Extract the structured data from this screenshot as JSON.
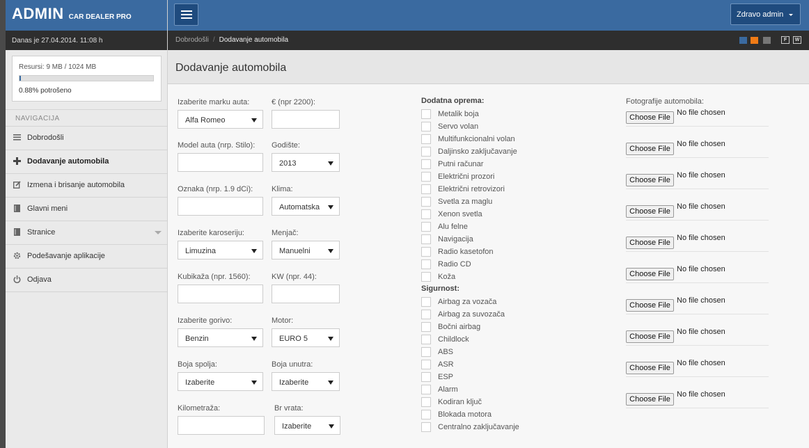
{
  "brand": {
    "title": "ADMIN",
    "subtitle": "CAR DEALER PRO"
  },
  "date_text": "Danas je 27.04.2014. 11:08 h",
  "resources": {
    "label": "Resursi: 9 MB / 1024 MB",
    "used_fraction": 0.0088,
    "used_text": "0.88% potrošeno"
  },
  "nav": {
    "heading": "NAVIGACIJA",
    "items": [
      {
        "label": "Dobrodošli",
        "icon": "list-icon"
      },
      {
        "label": "Dodavanje automobila",
        "icon": "plus-icon"
      },
      {
        "label": "Izmena i brisanje automobila",
        "icon": "edit-icon"
      },
      {
        "label": "Glavni meni",
        "icon": "book-icon"
      },
      {
        "label": "Stranice",
        "icon": "book-icon"
      },
      {
        "label": "Podešavanje aplikacije",
        "icon": "gear-icon"
      },
      {
        "label": "Odjava",
        "icon": "power-icon"
      }
    ]
  },
  "topbar": {
    "user_label": "Zdravo admin"
  },
  "breadcrumb": {
    "home": "Dobrodošli",
    "current": "Dodavanje automobila"
  },
  "theme": {
    "swatches": [
      "#3a6aa0",
      "#f07b16",
      "#777777"
    ],
    "toggle_f": "F",
    "toggle_w": "W"
  },
  "page_title": "Dodavanje automobila",
  "form": {
    "left_col": [
      {
        "label": "Izaberite marku auta:",
        "type": "select",
        "value": "Alfa Romeo"
      },
      {
        "label": "Model auta (nrp. Stilo):",
        "type": "text",
        "value": ""
      },
      {
        "label": "Oznaka (nrp. 1.9 dCi):",
        "type": "text",
        "value": ""
      },
      {
        "label": "Izaberite karoseriju:",
        "type": "select",
        "value": "Limuzina"
      },
      {
        "label": "Kubikaža (npr. 1560):",
        "type": "text",
        "value": ""
      },
      {
        "label": "Izaberite gorivo:",
        "type": "select",
        "value": "Benzin"
      },
      {
        "label": "Boja spolja:",
        "type": "select",
        "value": "Izaberite"
      },
      {
        "label": "Kilometraža:",
        "type": "text",
        "value": ""
      }
    ],
    "right_col": [
      {
        "label": "€ (npr 2200):",
        "type": "text",
        "value": ""
      },
      {
        "label": "Godište:",
        "type": "select",
        "value": "2013"
      },
      {
        "label": "Klima:",
        "type": "select",
        "value": "Automatska"
      },
      {
        "label": "Menjač:",
        "type": "select",
        "value": "Manuelni"
      },
      {
        "label": "KW (npr. 44):",
        "type": "text",
        "value": ""
      },
      {
        "label": "Motor:",
        "type": "select",
        "value": "EURO 5"
      },
      {
        "label": "Boja unutra:",
        "type": "select",
        "value": "Izaberite"
      },
      {
        "label": "Br vrata:",
        "type": "select",
        "value": "Izaberite"
      }
    ]
  },
  "equipment": {
    "heading": "Dodatna oprema:",
    "items": [
      "Metalik boja",
      "Servo volan",
      "Multifunkcionalni volan",
      "Daljinsko zaključavanje",
      "Putni računar",
      "Električni prozori",
      "Električni retrovizori",
      "Svetla za maglu",
      "Xenon svetla",
      "Alu felne",
      "Navigacija",
      "Radio kasetofon",
      "Radio CD",
      "Koža"
    ]
  },
  "safety": {
    "heading": "Sigurnost:",
    "items": [
      "Airbag za vozača",
      "Airbag za suvozača",
      "Bočni airbag",
      "Childlock",
      "ABS",
      "ASR",
      "ESP",
      "Alarm",
      "Kodiran ključ",
      "Blokada motora",
      "Centralno zaključavanje"
    ]
  },
  "photos": {
    "heading": "Fotografije automobila:",
    "button_label": "Choose File",
    "status": "No file chosen",
    "count": 10
  }
}
